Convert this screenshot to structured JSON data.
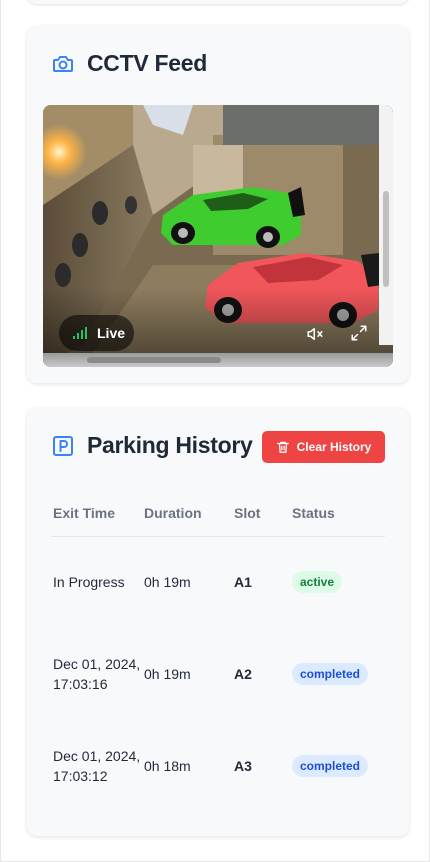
{
  "cctv": {
    "title": "CCTV Feed",
    "icon": "camera-icon",
    "live_label": "Live",
    "accent": "#3b82f6"
  },
  "history": {
    "title": "Parking History",
    "icon": "parking-icon",
    "clear_button": "Clear History",
    "columns": [
      "Exit Time",
      "Duration",
      "Slot",
      "Status"
    ],
    "rows": [
      {
        "exit_time": "In Progress",
        "duration": "0h 19m",
        "slot": "A1",
        "status": "active"
      },
      {
        "exit_time": "Dec 01, 2024, 17:03:16",
        "duration": "0h 19m",
        "slot": "A2",
        "status": "completed"
      },
      {
        "exit_time": "Dec 01, 2024, 17:03:12",
        "duration": "0h 18m",
        "slot": "A3",
        "status": "completed"
      }
    ]
  },
  "colors": {
    "danger": "#ef4444",
    "active_bg": "#dcfce7",
    "active_text": "#15803d",
    "completed_bg": "#dbeafe",
    "completed_text": "#1d4ed8"
  }
}
